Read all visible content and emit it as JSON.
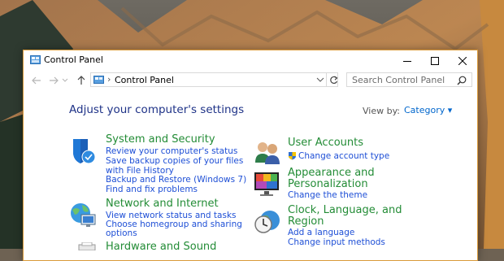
{
  "window": {
    "title": "Control Panel"
  },
  "address": {
    "path": "Control Panel",
    "search_placeholder": "Search Control Panel"
  },
  "content": {
    "heading": "Adjust your computer's settings",
    "view_by_label": "View by:",
    "view_by_value": "Category ▾"
  },
  "categories_left": [
    {
      "title": "System and Security",
      "icon": "shield-icon",
      "links": [
        "Review your computer's status",
        "Save backup copies of your files",
        "with File History",
        "Backup and Restore (Windows 7)",
        "Find and fix problems"
      ]
    },
    {
      "title": "Network and Internet",
      "icon": "network-globe-icon",
      "links": [
        "View network status and tasks",
        "Choose homegroup and sharing",
        "options"
      ]
    },
    {
      "title": "Hardware and Sound",
      "icon": "printer-icon",
      "links": []
    }
  ],
  "categories_right": [
    {
      "title": "User Accounts",
      "icon": "users-icon",
      "links": [
        "Change account type"
      ]
    },
    {
      "title_line1": "Appearance and",
      "title_line2": "Personalization",
      "icon": "monitor-icon",
      "links": [
        "Change the theme"
      ]
    },
    {
      "title_line1": "Clock, Language, and",
      "title_line2": "Region",
      "icon": "clock-globe-icon",
      "links": [
        "Add a language",
        "Change input methods"
      ]
    }
  ],
  "colors": {
    "heading": "#1e3287",
    "category_title": "#238c36",
    "link": "#1e4fd6",
    "window_border": "#d99a3a"
  }
}
